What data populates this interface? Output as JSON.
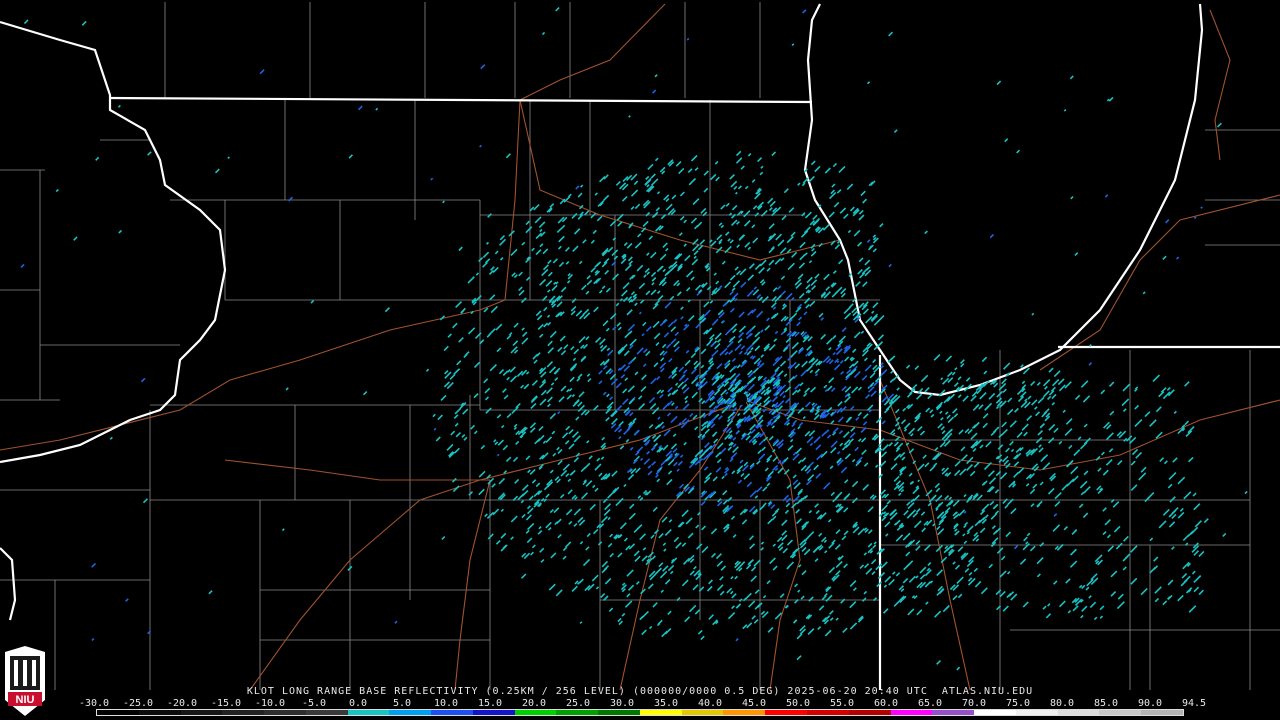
{
  "product": {
    "caption": "KLOT LONG RANGE BASE REFLECTIVITY (0.25KM / 256 LEVEL) (000000/0000 0.5 DEG) 2025-06-20 20:40 UTC  ATLAS.NIU.EDU"
  },
  "logo": {
    "text": "NIU",
    "color": "#c8102e"
  },
  "legend": {
    "ticks": [
      "-30.0",
      "-25.0",
      "-20.0",
      "-15.0",
      "-10.0",
      "-5.0",
      "0.0",
      "5.0",
      "10.0",
      "15.0",
      "20.0",
      "25.0",
      "30.0",
      "35.0",
      "40.0",
      "45.0",
      "50.0",
      "55.0",
      "60.0",
      "65.0",
      "70.0",
      "75.0",
      "80.0",
      "85.0",
      "90.0",
      "94.5"
    ],
    "colors": [
      "#000000",
      "#0b0b0b",
      "#161616",
      "#222222",
      "#2e2e2e",
      "#3a3a3a",
      "#19c3c3",
      "#00a0f0",
      "#1e50f0",
      "#1414c8",
      "#00d000",
      "#00a000",
      "#007800",
      "#ffff00",
      "#e6c800",
      "#ff9600",
      "#ff0000",
      "#d20000",
      "#b40000",
      "#ff00ff",
      "#9650c8",
      "#ffffff",
      "#f0f0f0",
      "#dcdcdc",
      "#c8c8c8",
      "#b4b4b4"
    ]
  },
  "map_colors": {
    "state_borders": "#ffffff",
    "county_lines": "#8a8a8a",
    "roads": "#a0522d",
    "echo_light": "#19c3c3",
    "echo_dark": "#1e64e6"
  }
}
